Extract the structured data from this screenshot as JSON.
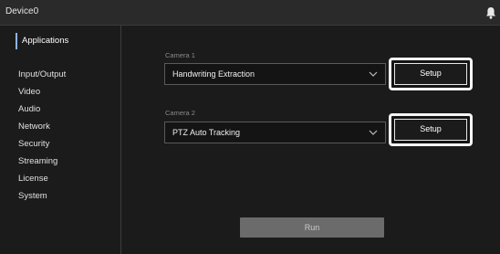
{
  "app": {
    "title": "Device0"
  },
  "sidebar": {
    "active": "Applications",
    "items": [
      "Input/Output",
      "Video",
      "Audio",
      "Network",
      "Security",
      "Streaming",
      "License",
      "System"
    ]
  },
  "camera1": {
    "label": "Camera 1",
    "selected": "Handwriting Extraction",
    "setup_label": "Setup"
  },
  "camera2": {
    "label": "Camera 2",
    "selected": "PTZ Auto Tracking",
    "setup_label": "Setup"
  },
  "run_label": "Run",
  "icons": {
    "notification": "bell-icon",
    "dropdown": "chevron-down-icon"
  },
  "colors": {
    "accent": "#8fb3ff",
    "background": "#1b1b1b",
    "run_disabled": "#6b6b6b"
  }
}
